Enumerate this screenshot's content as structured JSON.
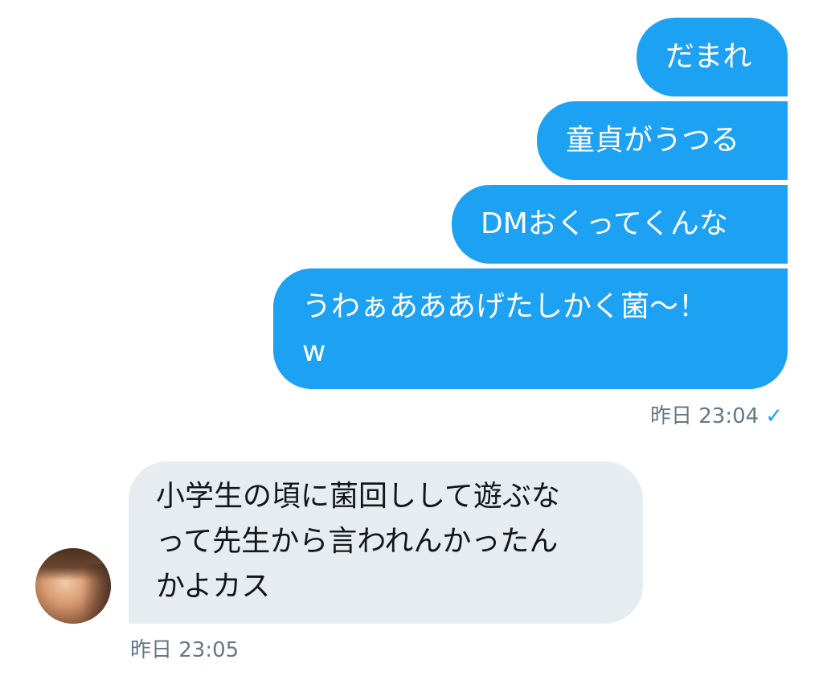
{
  "conversation": {
    "sent_messages": [
      {
        "text": "だまれ"
      },
      {
        "text": "童貞がうつる"
      },
      {
        "text": "DMおくってくんな"
      },
      {
        "text": "うわぁあああげたしかく菌〜！\nw"
      }
    ],
    "sent_timestamp": "昨日 23:04",
    "sent_status_icon": "✓",
    "received_message": {
      "text": "小学生の頃に菌回しして遊ぶな\nって先生から言われんかったん\nかよカス"
    },
    "received_timestamp": "昨日 23:05",
    "avatar_icon": "user-avatar"
  },
  "colors": {
    "sent_bubble": "#1da1f2",
    "received_bubble": "#e6ecf0",
    "meta_text": "#657786"
  }
}
